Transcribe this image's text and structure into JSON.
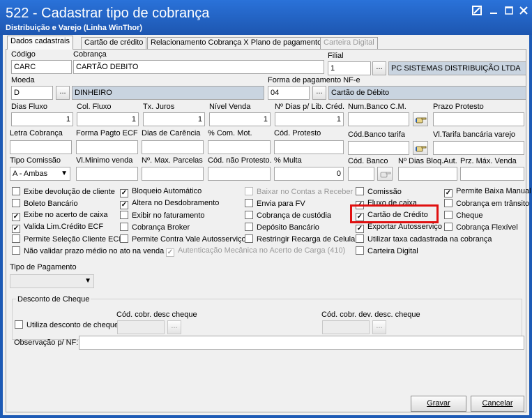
{
  "window": {
    "title": "522 - Cadastrar tipo de cobrança",
    "subtitle": "Distribuição e Varejo (Linha WinThor)",
    "restore_icon": "restore-icon",
    "minimize_icon": "minimize-icon",
    "maximize_icon": "maximize-icon",
    "close_icon": "close-icon"
  },
  "tabs": [
    {
      "label": "Dados cadastrais",
      "state": "active"
    },
    {
      "label": "Cartão de crédito",
      "state": "normal"
    },
    {
      "label": "Relacionamento Cobrança X Plano de pagamento",
      "state": "normal"
    },
    {
      "label": "Carteira Digital",
      "state": "disabled"
    }
  ],
  "form": {
    "codigo": {
      "label": "Código",
      "value": "CARC"
    },
    "cobranca": {
      "label": "Cobrança",
      "value": "CARTÃO DEBITO"
    },
    "filial": {
      "label": "Filial",
      "value": "1",
      "desc": "PC SISTEMAS DISTRIBUIÇÃO LTDA"
    },
    "moeda": {
      "label": "Moeda",
      "value": "D",
      "desc": "DINHEIRO"
    },
    "forma_pagamento_nfe": {
      "label": "Forma de pagamento NF-e",
      "value": "04",
      "desc": "Cartão de Débito"
    },
    "lookup_label": "...",
    "dias_fluxo": {
      "label": "Dias Fluxo",
      "value": "1"
    },
    "col_fluxo": {
      "label": "Col. Fluxo",
      "value": "1"
    },
    "tx_juros": {
      "label": "Tx. Juros",
      "value": "1"
    },
    "nivel_venda": {
      "label": "Nível Venda",
      "value": "1"
    },
    "dias_lib_cred": {
      "label": "Nº Dias p/ Lib. Créd.",
      "value": "1"
    },
    "num_banco_cm": {
      "label": "Num.Banco C.M.",
      "value": ""
    },
    "prazo_protesto": {
      "label": "Prazo Protesto",
      "value": ""
    },
    "letra_cobranca": {
      "label": "Letra Cobrança",
      "value": ""
    },
    "forma_pagto_ecf": {
      "label": "Forma Pagto ECF",
      "value": ""
    },
    "dias_carencia": {
      "label": "Dias de Carência",
      "value": ""
    },
    "com_mot": {
      "label": "% Com. Mot.",
      "value": ""
    },
    "cod_protesto": {
      "label": "Cód. Protesto",
      "value": ""
    },
    "cod_banco_tarifa": {
      "label": "Cód.Banco tarifa",
      "value": ""
    },
    "vl_tarifa_bancaria_varejo": {
      "label": "Vl.Tarifa bancária varejo",
      "value": ""
    },
    "tipo_comissao": {
      "label": "Tipo Comissão",
      "value": "A - Ambas"
    },
    "vl_minimo_venda": {
      "label": "Vl.Minimo venda",
      "value": ""
    },
    "max_parcelas": {
      "label": "Nº. Max. Parcelas",
      "value": ""
    },
    "cod_nao_protesto": {
      "label": "Cód. não Protesto.",
      "value": ""
    },
    "multa": {
      "label": "% Multa",
      "value": "0"
    },
    "cod_banco": {
      "label": "Cód. Banco",
      "value": ""
    },
    "dias_bloq_aut": {
      "label": "Nº Dias Bloq.Aut.",
      "value": ""
    },
    "prz_max_venda": {
      "label": "Prz. Máx. Venda",
      "value": ""
    },
    "picker_icon": "pointing-hand-icon"
  },
  "checkboxes": [
    {
      "label": "Exibe devolução de cliente",
      "checked": false,
      "disabled": false
    },
    {
      "label": "Boleto Bancário",
      "checked": false,
      "disabled": false
    },
    {
      "label": "Exibe no acerto de caixa",
      "checked": true,
      "disabled": false
    },
    {
      "label": "Valida Lim.Crédito ECF",
      "checked": true,
      "disabled": false
    },
    {
      "label": "Permite Seleção Cliente ECF",
      "checked": false,
      "disabled": false
    },
    {
      "label": "Não validar prazo médio no ato na venda",
      "checked": false,
      "disabled": false
    },
    {
      "label": "Bloqueio Automático",
      "checked": true,
      "disabled": false
    },
    {
      "label": "Altera no Desdobramento",
      "checked": true,
      "disabled": false
    },
    {
      "label": "Exibir no faturamento",
      "checked": false,
      "disabled": false
    },
    {
      "label": "Cobrança Broker",
      "checked": false,
      "disabled": false
    },
    {
      "label": "Permite Contra Vale Autosserviço",
      "checked": false,
      "disabled": false
    },
    {
      "label": "Autenticação Mecânica no Acerto de Carga (410)",
      "checked": true,
      "disabled": true
    },
    {
      "label": "Baixar no Contas a Receber",
      "checked": false,
      "disabled": true
    },
    {
      "label": "Envia para FV",
      "checked": false,
      "disabled": false
    },
    {
      "label": "Cobrança de custódia",
      "checked": false,
      "disabled": false
    },
    {
      "label": "Depósito Bancário",
      "checked": false,
      "disabled": false
    },
    {
      "label": "Restringir Recarga de Celular",
      "checked": false,
      "disabled": false
    },
    {
      "label": "Comissão",
      "checked": false,
      "disabled": false
    },
    {
      "label": "Fluxo de caixa",
      "checked": true,
      "disabled": false
    },
    {
      "label": "Cartão de Crédito",
      "checked": true,
      "disabled": false
    },
    {
      "label": "Exportar Autosserviço",
      "checked": true,
      "disabled": false
    },
    {
      "label": "Utilizar taxa cadastrada na cobrança",
      "checked": false,
      "disabled": false
    },
    {
      "label": "Carteira Digital",
      "checked": false,
      "disabled": false
    },
    {
      "label": "Permite Baixa Manual",
      "checked": true,
      "disabled": false
    },
    {
      "label": "Cobrança em trânsito",
      "checked": false,
      "disabled": false
    },
    {
      "label": "Cheque",
      "checked": false,
      "disabled": false
    },
    {
      "label": "Cobrança Flexível",
      "checked": false,
      "disabled": false
    }
  ],
  "tipo_pagamento": {
    "label": "Tipo de Pagamento",
    "value": ""
  },
  "desconto_cheque": {
    "title": "Desconto de Cheque",
    "utiliza_label": "Utiliza desconto de cheque",
    "utiliza_checked": false,
    "cod_desc_label": "Cód. cobr. desc cheque",
    "cod_dev_label": "Cód. cobr. dev. desc. cheque"
  },
  "observacao": {
    "label": "Observação p/ NF:",
    "value": ""
  },
  "buttons": {
    "gravar": "Gravar",
    "cancelar": "Cancelar"
  },
  "highlight_color": "#e01010"
}
